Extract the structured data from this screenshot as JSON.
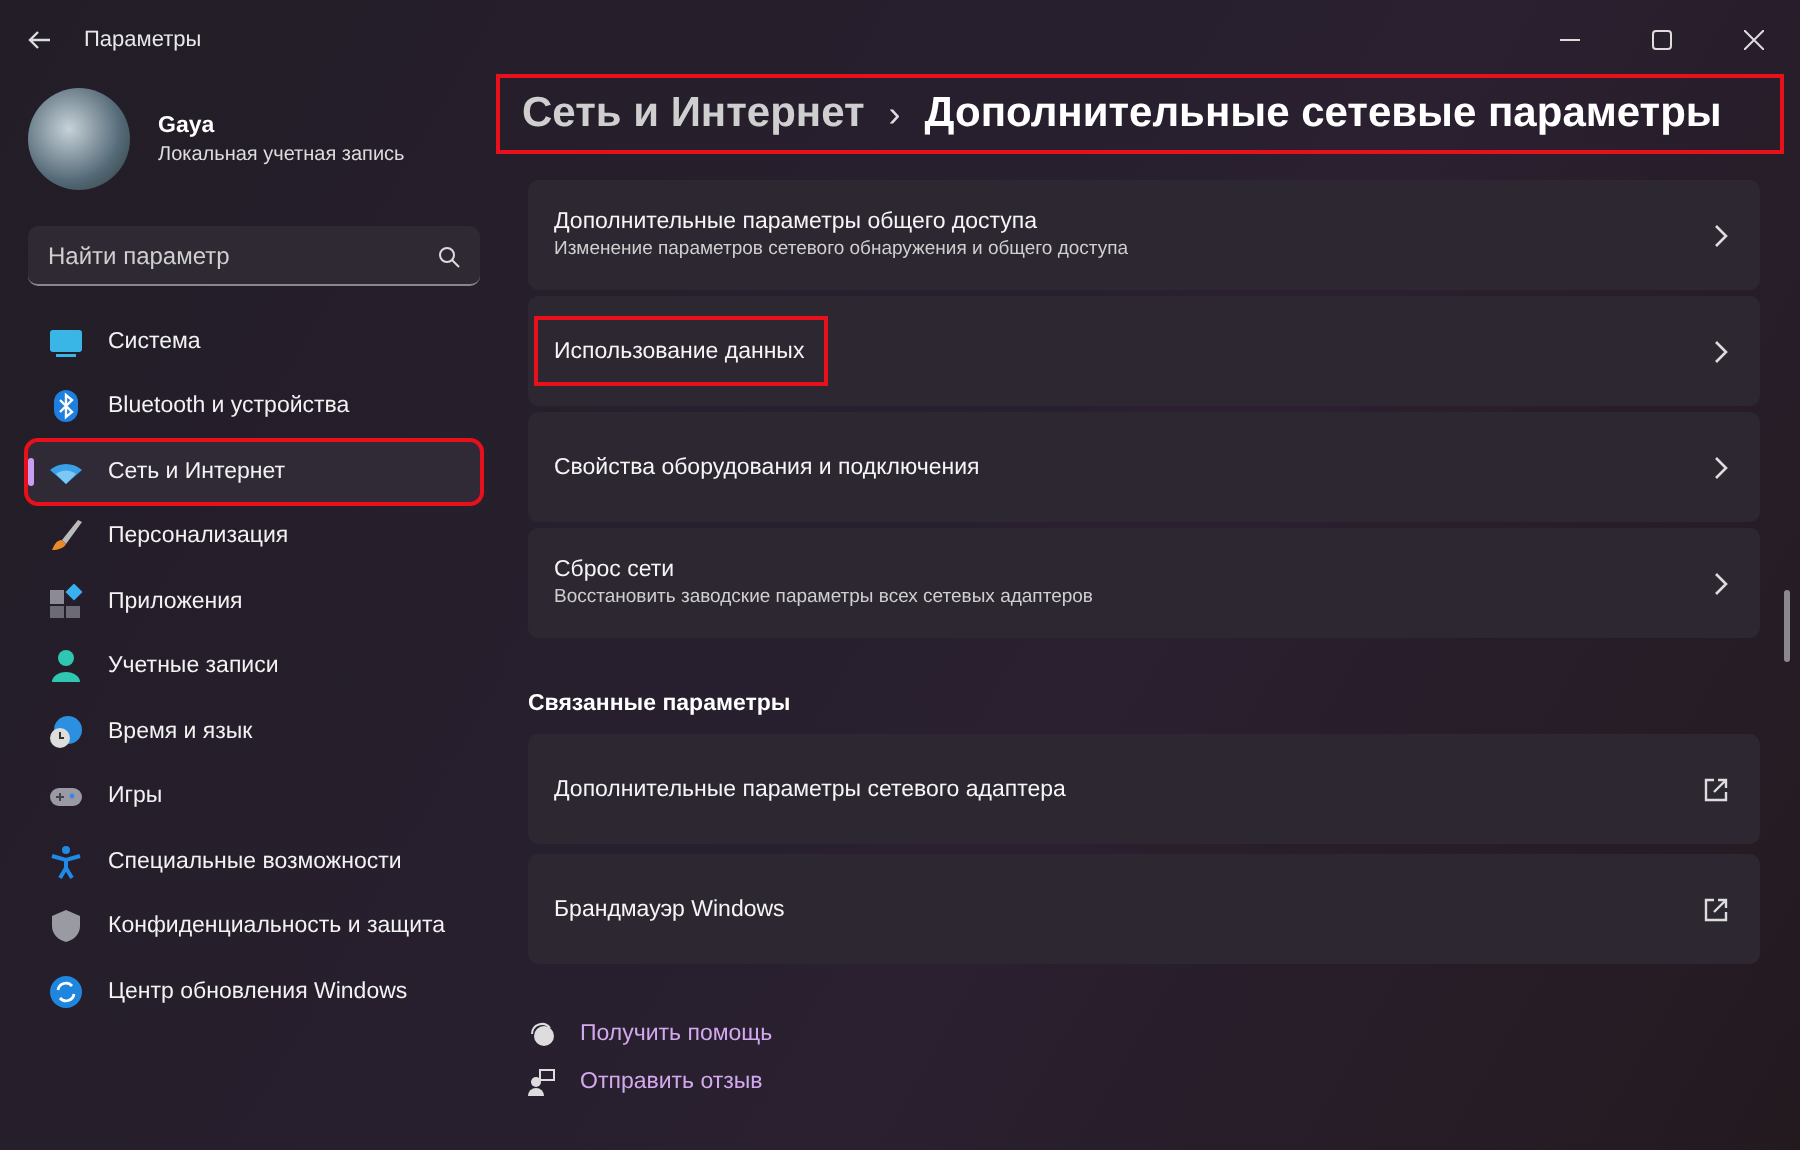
{
  "window": {
    "title": "Параметры"
  },
  "profile": {
    "name": "Gaya",
    "account": "Локальная учетная запись"
  },
  "search": {
    "placeholder": "Найти параметр"
  },
  "sidebar": {
    "items": [
      {
        "label": "Система",
        "selected": false,
        "highlighted": false
      },
      {
        "label": "Bluetooth и устройства",
        "selected": false,
        "highlighted": false
      },
      {
        "label": "Сеть и Интернет",
        "selected": true,
        "highlighted": true
      },
      {
        "label": "Персонализация",
        "selected": false,
        "highlighted": false
      },
      {
        "label": "Приложения",
        "selected": false,
        "highlighted": false
      },
      {
        "label": "Учетные записи",
        "selected": false,
        "highlighted": false
      },
      {
        "label": "Время и язык",
        "selected": false,
        "highlighted": false
      },
      {
        "label": "Игры",
        "selected": false,
        "highlighted": false
      },
      {
        "label": "Специальные возможности",
        "selected": false,
        "highlighted": false
      },
      {
        "label": "Конфиденциальность и защита",
        "selected": false,
        "highlighted": false
      },
      {
        "label": "Центр обновления Windows",
        "selected": false,
        "highlighted": false
      }
    ]
  },
  "breadcrumb": {
    "parent": "Сеть и Интернет",
    "separator": "›",
    "current": "Дополнительные сетевые параметры",
    "highlighted": true
  },
  "settings": [
    {
      "title": "Дополнительные параметры общего доступа",
      "description": "Изменение параметров сетевого обнаружения и общего доступа",
      "highlighted": false
    },
    {
      "title": "Использование данных",
      "highlighted": true
    },
    {
      "title": "Свойства оборудования и подключения",
      "highlighted": false
    },
    {
      "title": "Сброс сети",
      "description": "Восстановить заводские параметры всех сетевых адаптеров",
      "highlighted": false
    }
  ],
  "related": {
    "heading": "Связанные параметры",
    "items": [
      {
        "title": "Дополнительные параметры сетевого адаптера",
        "highlighted": false
      },
      {
        "title": "Брандмауэр Windows",
        "highlighted": false
      }
    ]
  },
  "links": [
    {
      "label": "Получить помощь",
      "kind": "help"
    },
    {
      "label": "Отправить отзыв",
      "kind": "feedback"
    }
  ]
}
